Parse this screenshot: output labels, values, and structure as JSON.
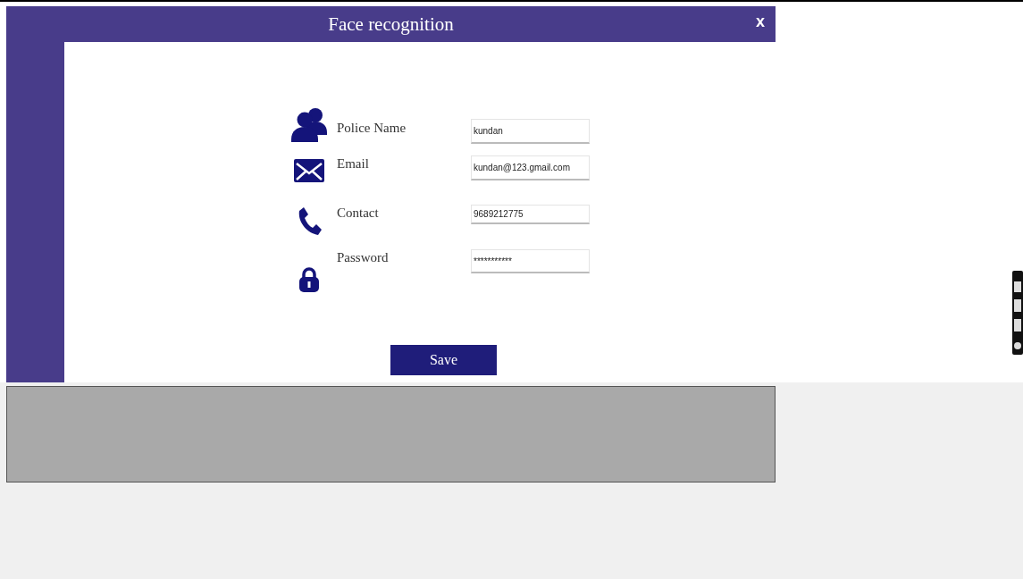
{
  "window": {
    "title": "Face recognition",
    "close": "x"
  },
  "fields": [
    {
      "kind": "person",
      "label": "Police Name",
      "value": "kundan"
    },
    {
      "kind": "email",
      "label": "Email",
      "value": "kundan@123.gmail.com"
    },
    {
      "kind": "phone",
      "label": "Contact",
      "value": "9689212775"
    },
    {
      "kind": "lock",
      "label": "Password",
      "value": "***********"
    }
  ],
  "save_button": "Save"
}
